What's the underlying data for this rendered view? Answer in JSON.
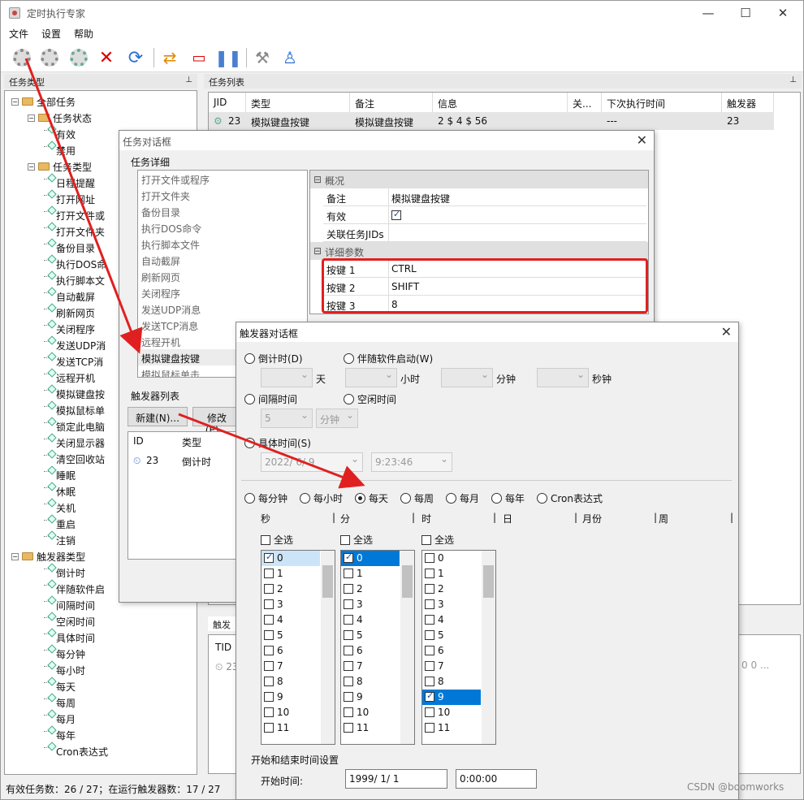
{
  "app": {
    "title": "定时执行专家"
  },
  "menu": [
    "文件",
    "设置",
    "帮助"
  ],
  "left_panel": {
    "header": "任务类型",
    "pin": "⊥"
  },
  "tree": [
    {
      "label": "全部任务",
      "level": 0,
      "kind": "folder"
    },
    {
      "label": "任务状态",
      "level": 1,
      "kind": "folder"
    },
    {
      "label": "有效",
      "level": 2,
      "kind": "leaf"
    },
    {
      "label": "禁用",
      "level": 2,
      "kind": "leaf"
    },
    {
      "label": "任务类型",
      "level": 1,
      "kind": "folder"
    },
    {
      "label": "日程提醒",
      "level": 2,
      "kind": "leaf"
    },
    {
      "label": "打开网址",
      "level": 2,
      "kind": "leaf"
    },
    {
      "label": "打开文件或",
      "level": 2,
      "kind": "leaf"
    },
    {
      "label": "打开文件夹",
      "level": 2,
      "kind": "leaf"
    },
    {
      "label": "备份目录",
      "level": 2,
      "kind": "leaf"
    },
    {
      "label": "执行DOS命",
      "level": 2,
      "kind": "leaf"
    },
    {
      "label": "执行脚本文",
      "level": 2,
      "kind": "leaf"
    },
    {
      "label": "自动截屏",
      "level": 2,
      "kind": "leaf"
    },
    {
      "label": "刷新网页",
      "level": 2,
      "kind": "leaf"
    },
    {
      "label": "关闭程序",
      "level": 2,
      "kind": "leaf"
    },
    {
      "label": "发送UDP消",
      "level": 2,
      "kind": "leaf"
    },
    {
      "label": "发送TCP消",
      "level": 2,
      "kind": "leaf"
    },
    {
      "label": "远程开机",
      "level": 2,
      "kind": "leaf"
    },
    {
      "label": "模拟键盘按",
      "level": 2,
      "kind": "leaf"
    },
    {
      "label": "模拟鼠标单",
      "level": 2,
      "kind": "leaf"
    },
    {
      "label": "锁定此电脑",
      "level": 2,
      "kind": "leaf"
    },
    {
      "label": "关闭显示器",
      "level": 2,
      "kind": "leaf"
    },
    {
      "label": "清空回收站",
      "level": 2,
      "kind": "leaf"
    },
    {
      "label": "睡眠",
      "level": 2,
      "kind": "leaf"
    },
    {
      "label": "休眠",
      "level": 2,
      "kind": "leaf"
    },
    {
      "label": "关机",
      "level": 2,
      "kind": "leaf"
    },
    {
      "label": "重启",
      "level": 2,
      "kind": "leaf"
    },
    {
      "label": "注销",
      "level": 2,
      "kind": "leaf"
    },
    {
      "label": "触发器类型",
      "level": 0,
      "kind": "folder"
    },
    {
      "label": "倒计时",
      "level": 2,
      "kind": "leaf"
    },
    {
      "label": "伴随软件启",
      "level": 2,
      "kind": "leaf"
    },
    {
      "label": "间隔时间",
      "level": 2,
      "kind": "leaf"
    },
    {
      "label": "空闲时间",
      "level": 2,
      "kind": "leaf"
    },
    {
      "label": "具体时间",
      "level": 2,
      "kind": "leaf"
    },
    {
      "label": "每分钟",
      "level": 2,
      "kind": "leaf"
    },
    {
      "label": "每小时",
      "level": 2,
      "kind": "leaf"
    },
    {
      "label": "每天",
      "level": 2,
      "kind": "leaf"
    },
    {
      "label": "每周",
      "level": 2,
      "kind": "leaf"
    },
    {
      "label": "每月",
      "level": 2,
      "kind": "leaf"
    },
    {
      "label": "每年",
      "level": 2,
      "kind": "leaf"
    },
    {
      "label": "Cron表达式",
      "level": 2,
      "kind": "leaf"
    }
  ],
  "task_list": {
    "header": "任务列表",
    "columns": [
      "JID",
      "类型",
      "备注",
      "信息",
      "关...",
      "下次执行时间",
      "触发器T..."
    ],
    "rows": [
      [
        "23",
        "模拟键盘按键",
        "模拟键盘按键",
        "2 $ 4 $ 56",
        "",
        "---",
        "23"
      ]
    ]
  },
  "trigger_panel": {
    "header": "触发",
    "col": "TID",
    "row": "23",
    "tail": "0 0 ..."
  },
  "status": "有效任务数：26 / 27；在运行触发器数：17 / 27",
  "watermark": "CSDN @boomworks",
  "task_dialog": {
    "title": "任务对话框",
    "detail_label": "任务详细",
    "items": [
      "打开文件或程序",
      "打开文件夹",
      "备份目录",
      "执行DOS命令",
      "执行脚本文件",
      "自动截屏",
      "刷新网页",
      "关闭程序",
      "发送UDP消息",
      "发送TCP消息",
      "远程开机",
      "模拟键盘按键",
      "模拟鼠标单击"
    ],
    "selected": "模拟键盘按键",
    "props": {
      "cat1": "概况",
      "remark_k": "备注",
      "remark_v": "模拟键盘按键",
      "valid_k": "有效",
      "jids_k": "关联任务JIDs",
      "cat2": "详细参数",
      "keys": [
        [
          "按键 1",
          "CTRL"
        ],
        [
          "按键 2",
          "SHIFT"
        ],
        [
          "按键 3",
          "8"
        ]
      ]
    },
    "trigger_list_label": "触发器列表",
    "new_btn": "新建(N)...",
    "edit_btn": "修改(E)...",
    "tcols": [
      "ID",
      "类型"
    ],
    "trow": [
      "23",
      "倒计时"
    ]
  },
  "trigger_dialog": {
    "title": "触发器对话框",
    "r_countdown": "倒计时(D)",
    "r_startup": "伴随软件启动(W)",
    "u_day": "天",
    "u_hour": "小时",
    "u_min": "分钟",
    "u_sec": "秒钟",
    "r_interval": "间隔时间",
    "r_idle": "空闲时间",
    "interval_val": "5",
    "interval_unit": "分钟",
    "r_specific": "具体时间(S)",
    "date_val": "2022/ 6/ 9",
    "time_val": "9:23:46",
    "freq": [
      "每分钟",
      "每小时",
      "每天",
      "每周",
      "每月",
      "每年",
      "Cron表达式"
    ],
    "freq_selected": "每天",
    "cols": [
      "秒",
      "分",
      "时",
      "日",
      "月份",
      "周"
    ],
    "select_all": "全选",
    "nums": [
      "0",
      "1",
      "2",
      "3",
      "4",
      "5",
      "6",
      "7",
      "8",
      "9",
      "10",
      "11"
    ],
    "range_label": "开始和结束时间设置",
    "start_label": "开始时间:",
    "start_date": "1999/ 1/ 1",
    "start_time": "0:00:00"
  },
  "colors": {
    "accent": "#0078d7",
    "highlight": "#e02020"
  }
}
